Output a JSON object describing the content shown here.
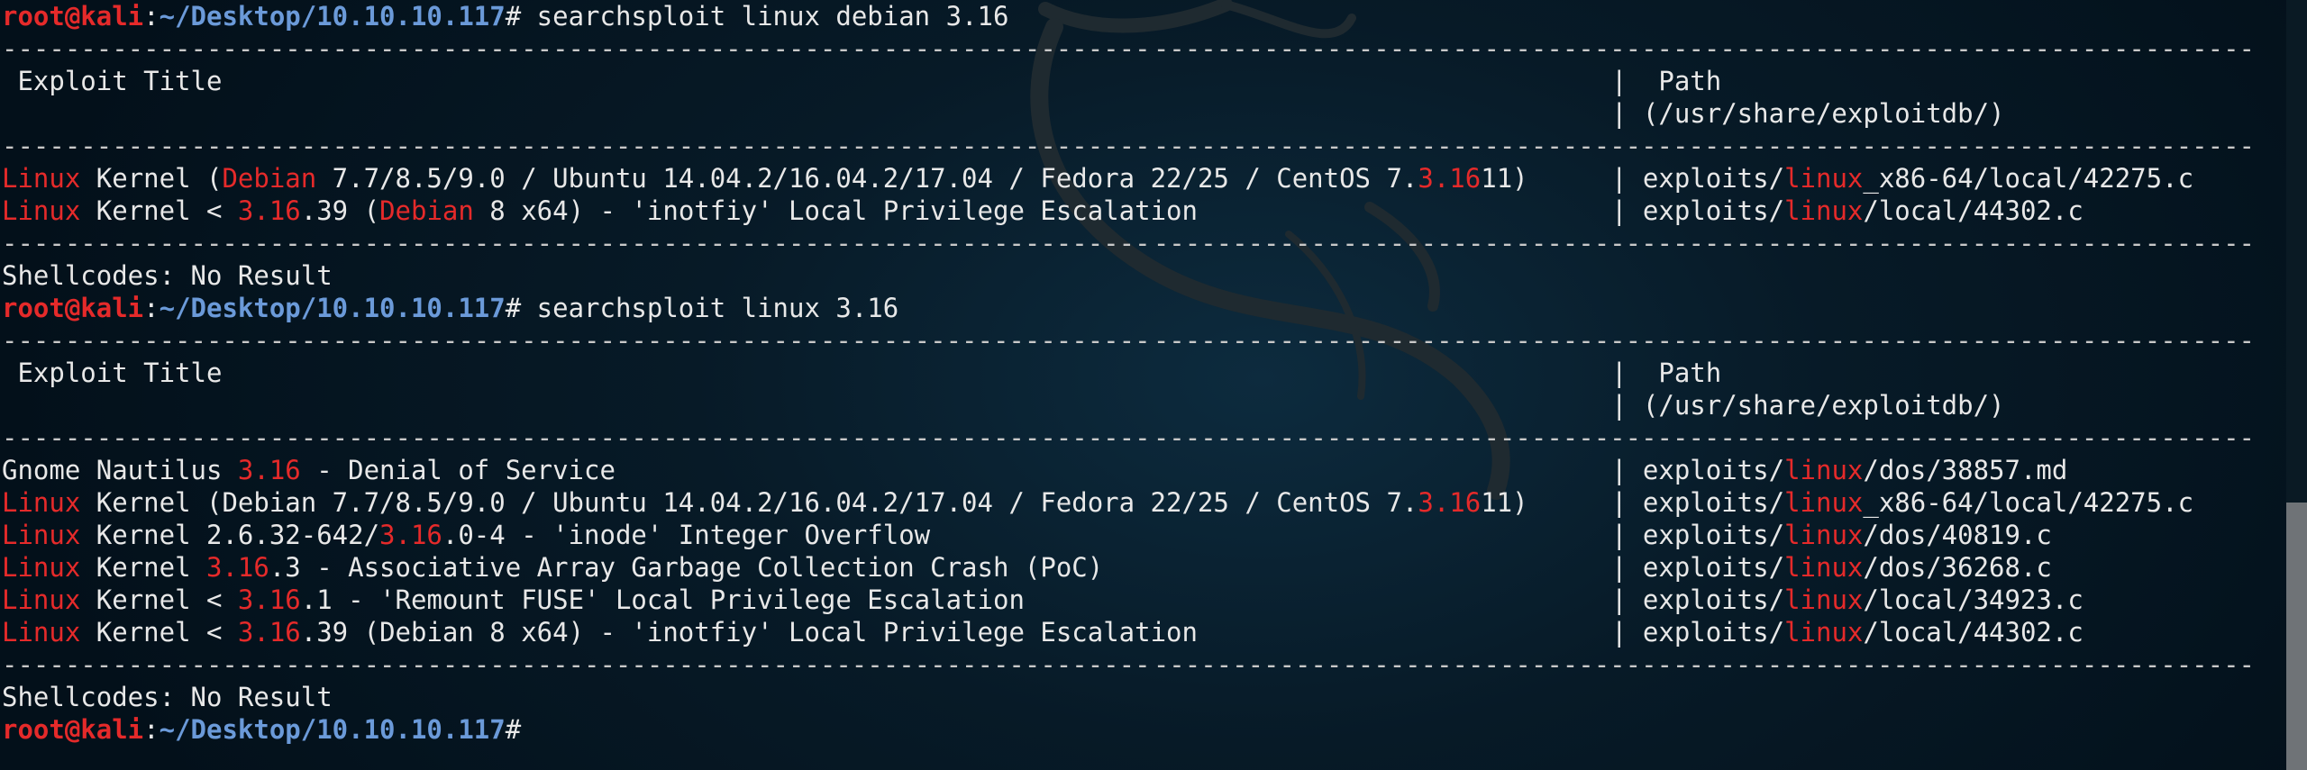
{
  "prompt": {
    "user": "root@kali",
    "sep": ":",
    "path": "~/Desktop/10.10.10.117",
    "hash": "#"
  },
  "rule": {
    "left": "---------------------------------------------------------------------------------------------------",
    "right": "----------------------------------------------------------------------"
  },
  "header": {
    "title": " Exploit Title",
    "path_label": "|  Path",
    "path_sub": "| (/usr/share/exploitdb/)"
  },
  "blocks": [
    {
      "command": "searchsploit linux debian 3.16",
      "rows": [
        {
          "title": [
            {
              "t": "Linux",
              "hl": true
            },
            {
              "t": " Kernel (",
              "hl": false
            },
            {
              "t": "Debian",
              "hl": true
            },
            {
              "t": " 7.7/8.5/9.0 / Ubuntu 14.04.2/16.04.2/17.04 / Fedora 22/25 / CentOS 7.",
              "hl": false
            },
            {
              "t": "3.16",
              "hl": true
            },
            {
              "t": "11)",
              "hl": false
            }
          ],
          "path": [
            {
              "t": "| exploits/",
              "hl": false
            },
            {
              "t": "linux",
              "hl": true
            },
            {
              "t": "_x86-64/local/42275.c",
              "hl": false
            }
          ]
        },
        {
          "title": [
            {
              "t": "Linux",
              "hl": true
            },
            {
              "t": " Kernel < ",
              "hl": false
            },
            {
              "t": "3.16",
              "hl": true
            },
            {
              "t": ".39 (",
              "hl": false
            },
            {
              "t": "Debian",
              "hl": true
            },
            {
              "t": " 8 x64) - 'inotfiy' Local Privilege Escalation",
              "hl": false
            }
          ],
          "path": [
            {
              "t": "| exploits/",
              "hl": false
            },
            {
              "t": "linux",
              "hl": true
            },
            {
              "t": "/local/44302.c",
              "hl": false
            }
          ]
        }
      ],
      "shellcodes": "Shellcodes: No Result"
    },
    {
      "command": "searchsploit linux 3.16",
      "rows": [
        {
          "title": [
            {
              "t": "Gnome Nautilus ",
              "hl": false
            },
            {
              "t": "3.16",
              "hl": true
            },
            {
              "t": " - Denial of Service",
              "hl": false
            }
          ],
          "path": [
            {
              "t": "| exploits/",
              "hl": false
            },
            {
              "t": "linux",
              "hl": true
            },
            {
              "t": "/dos/38857.md",
              "hl": false
            }
          ]
        },
        {
          "title": [
            {
              "t": "Linux",
              "hl": true
            },
            {
              "t": " Kernel (Debian 7.7/8.5/9.0 / Ubuntu 14.04.2/16.04.2/17.04 / Fedora 22/25 / CentOS 7.",
              "hl": false
            },
            {
              "t": "3.16",
              "hl": true
            },
            {
              "t": "11)",
              "hl": false
            }
          ],
          "path": [
            {
              "t": "| exploits/",
              "hl": false
            },
            {
              "t": "linux",
              "hl": true
            },
            {
              "t": "_x86-64/local/42275.c",
              "hl": false
            }
          ]
        },
        {
          "title": [
            {
              "t": "Linux",
              "hl": true
            },
            {
              "t": " Kernel 2.6.32-642/",
              "hl": false
            },
            {
              "t": "3.16",
              "hl": true
            },
            {
              "t": ".0-4 - 'inode' Integer Overflow",
              "hl": false
            }
          ],
          "path": [
            {
              "t": "| exploits/",
              "hl": false
            },
            {
              "t": "linux",
              "hl": true
            },
            {
              "t": "/dos/40819.c",
              "hl": false
            }
          ]
        },
        {
          "title": [
            {
              "t": "Linux",
              "hl": true
            },
            {
              "t": " Kernel ",
              "hl": false
            },
            {
              "t": "3.16",
              "hl": true
            },
            {
              "t": ".3 - Associative Array Garbage Collection Crash (PoC)",
              "hl": false
            }
          ],
          "path": [
            {
              "t": "| exploits/",
              "hl": false
            },
            {
              "t": "linux",
              "hl": true
            },
            {
              "t": "/dos/36268.c",
              "hl": false
            }
          ]
        },
        {
          "title": [
            {
              "t": "Linux",
              "hl": true
            },
            {
              "t": " Kernel < ",
              "hl": false
            },
            {
              "t": "3.16",
              "hl": true
            },
            {
              "t": ".1 - 'Remount FUSE' Local Privilege Escalation",
              "hl": false
            }
          ],
          "path": [
            {
              "t": "| exploits/",
              "hl": false
            },
            {
              "t": "linux",
              "hl": true
            },
            {
              "t": "/local/34923.c",
              "hl": false
            }
          ]
        },
        {
          "title": [
            {
              "t": "Linux",
              "hl": true
            },
            {
              "t": " Kernel < ",
              "hl": false
            },
            {
              "t": "3.16",
              "hl": true
            },
            {
              "t": ".39 (Debian 8 x64) - 'inotfiy' Local Privilege Escalation",
              "hl": false
            }
          ],
          "path": [
            {
              "t": "| exploits/",
              "hl": false
            },
            {
              "t": "linux",
              "hl": true
            },
            {
              "t": "/local/44302.c",
              "hl": false
            }
          ]
        }
      ],
      "shellcodes": "Shellcodes: No Result"
    }
  ],
  "colors": {
    "highlight": "#e52a2a",
    "prompt_path": "#6b9ad9",
    "text": "#e8e8e8"
  },
  "icons": {
    "background": "kali-dragon-icon"
  }
}
